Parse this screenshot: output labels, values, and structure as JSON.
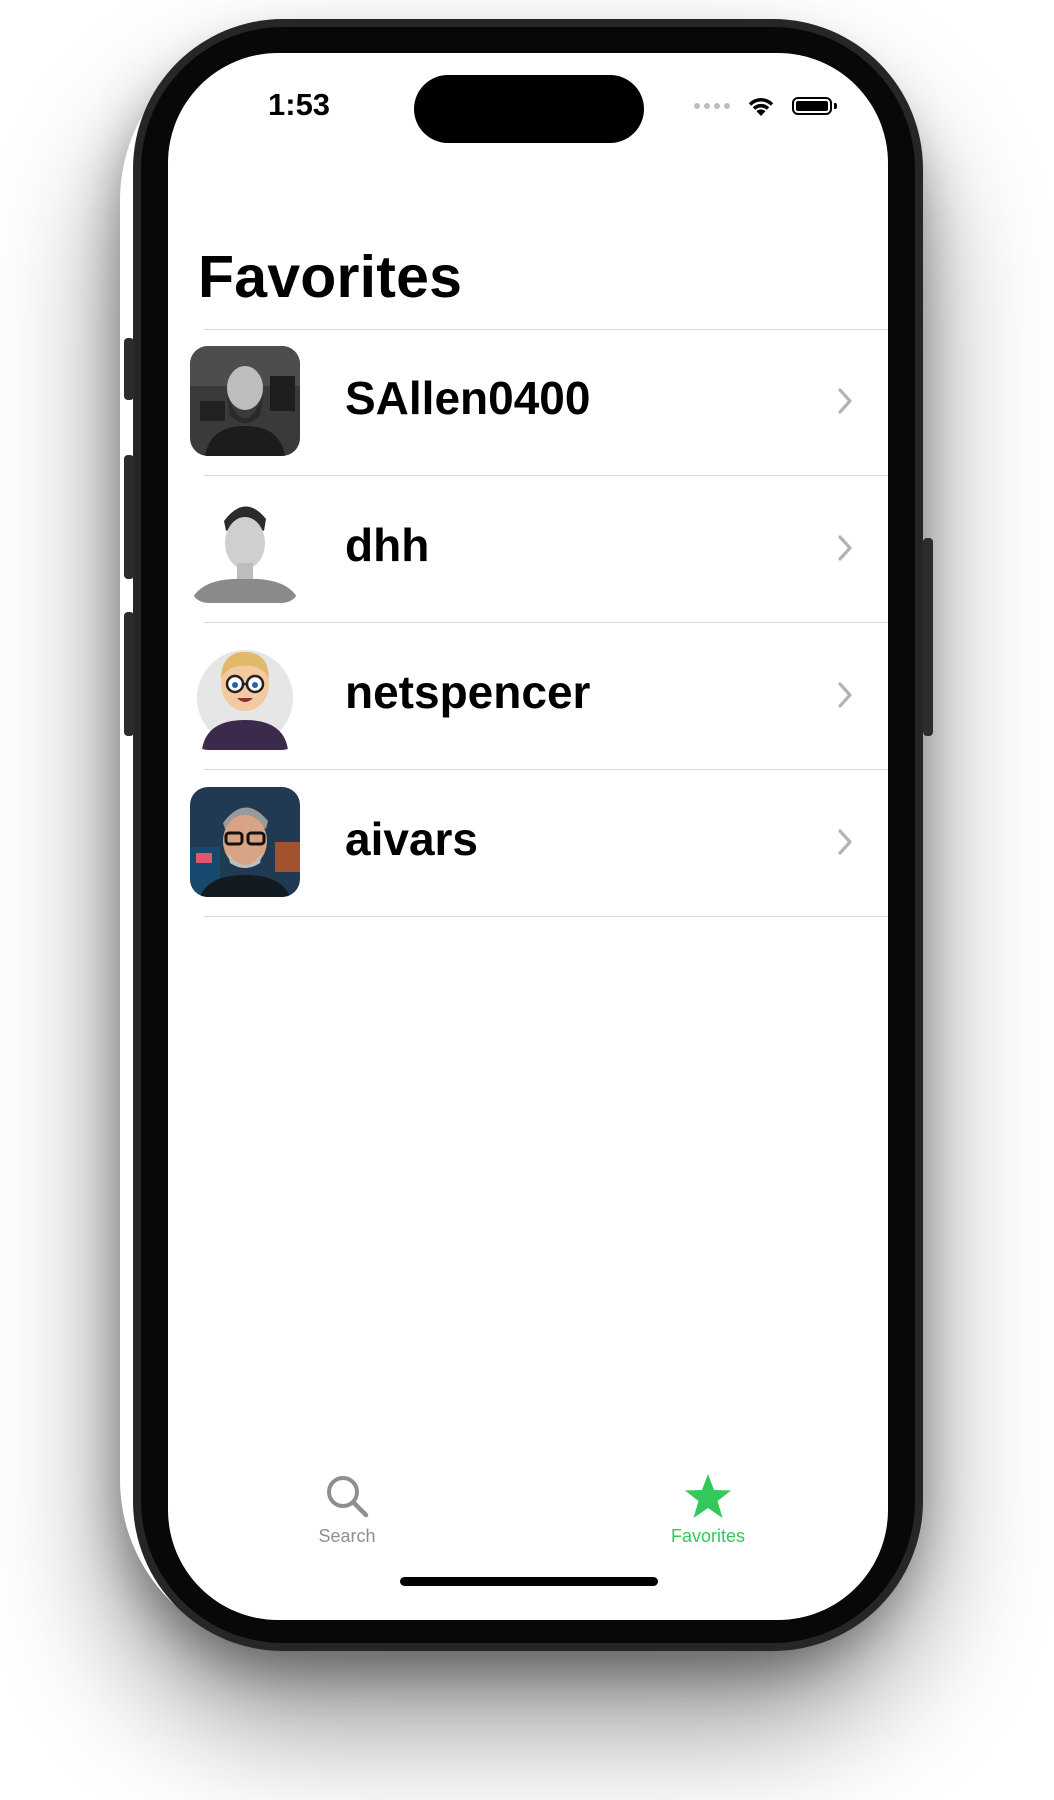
{
  "status_bar": {
    "time": "1:53"
  },
  "nav": {
    "title": "Favorites"
  },
  "favorites": [
    {
      "username": "SAllen0400"
    },
    {
      "username": "dhh"
    },
    {
      "username": "netspencer"
    },
    {
      "username": "aivars"
    }
  ],
  "tab_bar": {
    "tabs": [
      {
        "label": "Search",
        "icon": "magnifying-glass-icon",
        "selected": false
      },
      {
        "label": "Favorites",
        "icon": "star-icon",
        "selected": true
      }
    ]
  },
  "colors": {
    "accent": "#34c759",
    "inactive": "#8e8e93",
    "separator": "#d9d9d9"
  }
}
